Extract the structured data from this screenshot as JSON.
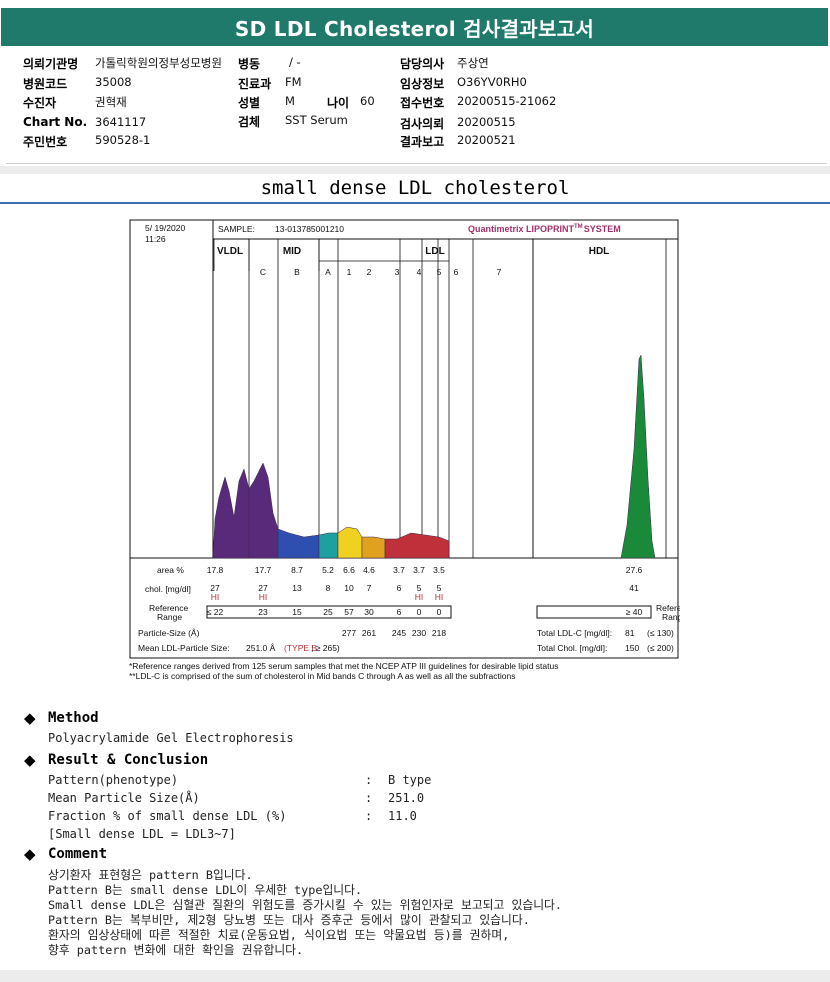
{
  "header": {
    "title": "SD LDL Cholesterol 검사결과보고서"
  },
  "info": {
    "hospital_label": "의뢰기관명",
    "hospital": "가톨릭학원의정부성모병원",
    "ward_label": "병동",
    "ward": "/ -",
    "doctor_label": "담당의사",
    "doctor": "주상연",
    "code_label": "병원코드",
    "code": "35008",
    "dept_label": "진료과",
    "dept": "FM",
    "clinical_label": "임상정보",
    "clinical": "O36YV0RH0",
    "patient_label": "수진자",
    "patient": "권혁재",
    "sex_label": "성별",
    "sex": "M",
    "age_label": "나이",
    "age": "60",
    "receipt_label": "접수번호",
    "receipt": "20200515-21062",
    "chart_label": "Chart No.",
    "chart": "3641117",
    "specimen_label": "검체",
    "specimen": "SST Serum",
    "request_label": "검사의뢰",
    "request": "20200515",
    "id_label": "주민번호",
    "id": "590528-1",
    "report_label": "결과보고",
    "report": "20200521"
  },
  "section_title": "small dense LDL cholesterol",
  "chart_data": {
    "type": "area",
    "date": "5/ 19/2020",
    "time": "11:26",
    "sample_label": "SAMPLE:",
    "sample": "13-013785001210",
    "brand": "Quantimetrix LIPOPRINT",
    "brand_tm": "TM",
    "brand_suffix": "SYSTEM",
    "groups": [
      "VLDL",
      "MID",
      "LDL",
      "HDL"
    ],
    "bands": [
      "C",
      "B",
      "A",
      "1",
      "2",
      "3",
      "4",
      "5",
      "6",
      "7"
    ],
    "rows": {
      "area_label": "area %",
      "area": [
        "17.8",
        "17.7",
        "8.7",
        "5.2",
        "6.6",
        "4.6",
        "3.7",
        "3.7",
        "3.5"
      ],
      "area_hdl": "27.6",
      "chol_label": "chol. [mg/dl]",
      "chol": [
        "27",
        "27",
        "13",
        "8",
        "10",
        "7",
        "6",
        "5",
        "5"
      ],
      "chol_hdl": "41",
      "flags": [
        "HI",
        "HI",
        "",
        "",
        "",
        "",
        "",
        "HI",
        "HI"
      ],
      "ref_label_1": "Reference",
      "ref_label_2": "Range",
      "ref": [
        "≤ 22",
        "23",
        "15",
        "25",
        "57",
        "30",
        "6",
        "0",
        "0"
      ],
      "ref_hdl": "≥ 40",
      "particle_label": "Particle-Size (Å)",
      "particle": [
        "277",
        "261",
        "245",
        "230",
        "218"
      ],
      "mean_label": "Mean LDL-Particle Size:",
      "mean_value": "251.0 Å",
      "mean_type": "(TYPE B",
      "mean_ref": "; ≥ 265)",
      "total_ldl_label": "Total LDL-C [mg/dl]:",
      "total_ldl": "81",
      "total_ldl_ref": "(≤ 130)",
      "total_chol_label": "Total Chol. [mg/dl]:",
      "total_chol": "150",
      "total_chol_ref": "(≤ 200)"
    },
    "colors": {
      "vldl": "#2a8a3a",
      "mid_c": "#5a2a7a",
      "mid_b": "#2f4fb0",
      "lipid_a": "#1fa0a0",
      "ldl1": "#f0d020",
      "ldl2": "#e0a020",
      "ldl3": "#c0303a",
      "hdl": "#1a8a3a"
    },
    "notes": [
      "*Reference ranges derived from 125 serum samples that met the NCEP ATP III guidelines for desirable lipid status",
      "**LDL-C is comprised of the sum of cholesterol in Mid bands C through A as well as all the subfractions"
    ]
  },
  "method": {
    "heading": "Method",
    "text": "Polyacrylamide Gel Electrophoresis"
  },
  "result": {
    "heading": "Result & Conclusion",
    "rows": [
      {
        "label": "Pattern(phenotype)",
        "sep": ":",
        "value": "B type"
      },
      {
        "label": "Mean Particle Size(Å)",
        "sep": ":",
        "value": "251.0"
      },
      {
        "label": "Fraction % of small dense LDL (%)",
        "sep": ":",
        "value": "11.0"
      }
    ],
    "note": "[Small dense LDL = LDL3~7]"
  },
  "comment": {
    "heading": "Comment",
    "lines": [
      "상기환자 표현형은 pattern B입니다.",
      "Pattern B는 small dense LDL이 우세한 type입니다.",
      "Small dense LDL은 심혈관 질환의 위험도를 증가시킬 수 있는 위험인자로 보고되고 있습니다.",
      "Pattern B는 복부비만, 제2형 당뇨병 또는 대사 증후군 등에서 많이 관찰되고 있습니다.",
      "환자의 임상상태에 따른 적절한 치료(운동요법, 식이요법 또는 약물요법 등)를 권하며,",
      "향후 pattern 변화에 대한 확인을 권유합니다."
    ]
  }
}
